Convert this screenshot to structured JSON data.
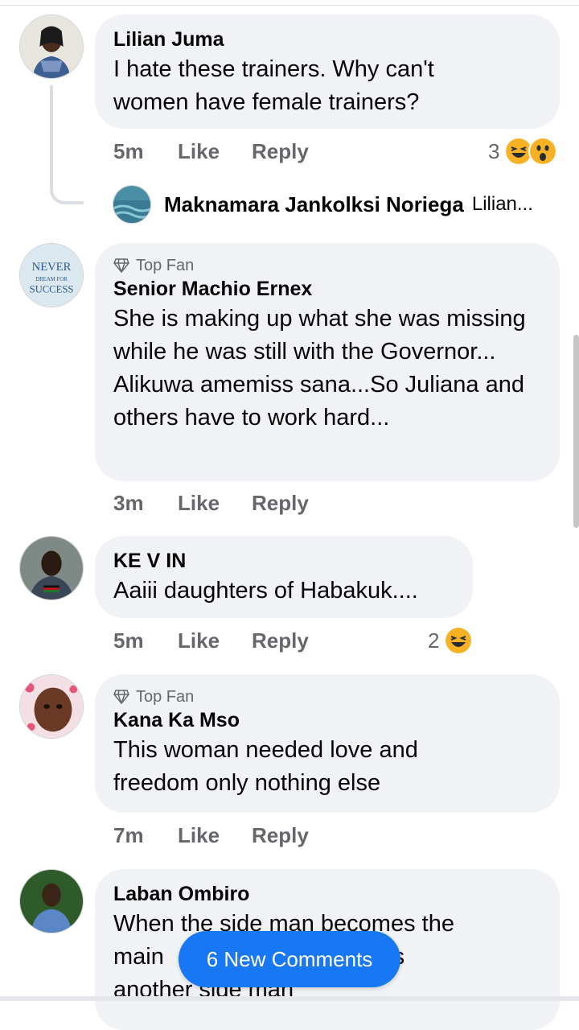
{
  "comments": [
    {
      "name": "Lilian Juma",
      "text": "I hate these trainers. Why can't women have female trainers?",
      "time": "5m",
      "like": "Like",
      "reply": "Reply",
      "reaction_count": "3",
      "reactions": [
        "haha",
        "wow"
      ]
    },
    {
      "badge": "Top Fan",
      "name": "Senior Machio Ernex",
      "text": "She is making up what she was missing while he was still with the Governor... Alikuwa amemiss sana...So Juliana and others have to work hard...",
      "time": "3m",
      "like": "Like",
      "reply": "Reply",
      "avatar_text": [
        "NEVER",
        "DREAM FOR",
        "SUCCESS"
      ]
    },
    {
      "name": "KE V IN",
      "text": "Aaiii daughters of Habakuk....",
      "time": "5m",
      "like": "Like",
      "reply": "Reply",
      "reaction_count": "2",
      "reactions": [
        "haha"
      ]
    },
    {
      "badge": "Top Fan",
      "name": "Kana Ka Mso",
      "text": "This woman needed love and freedom only nothing else",
      "time": "7m",
      "like": "Like",
      "reply": "Reply"
    },
    {
      "name": "Laban Ombiro",
      "line1": "When the side man becomes the",
      "line2_a": "main ",
      "line2_b": "sires",
      "line3": "another side man"
    }
  ],
  "reply_preview": {
    "name": "Maknamara Jankolksi Noriega",
    "text": "Lilian..."
  },
  "new_comments_label": "6 New Comments",
  "colors": {
    "bubble": "#f0f2f5",
    "meta": "#65676b",
    "accent": "#1877f2"
  },
  "icons": {
    "badge": "diamond-icon",
    "reaction_1": "laughing-emoji-icon",
    "reaction_2": "wow-emoji-icon"
  }
}
